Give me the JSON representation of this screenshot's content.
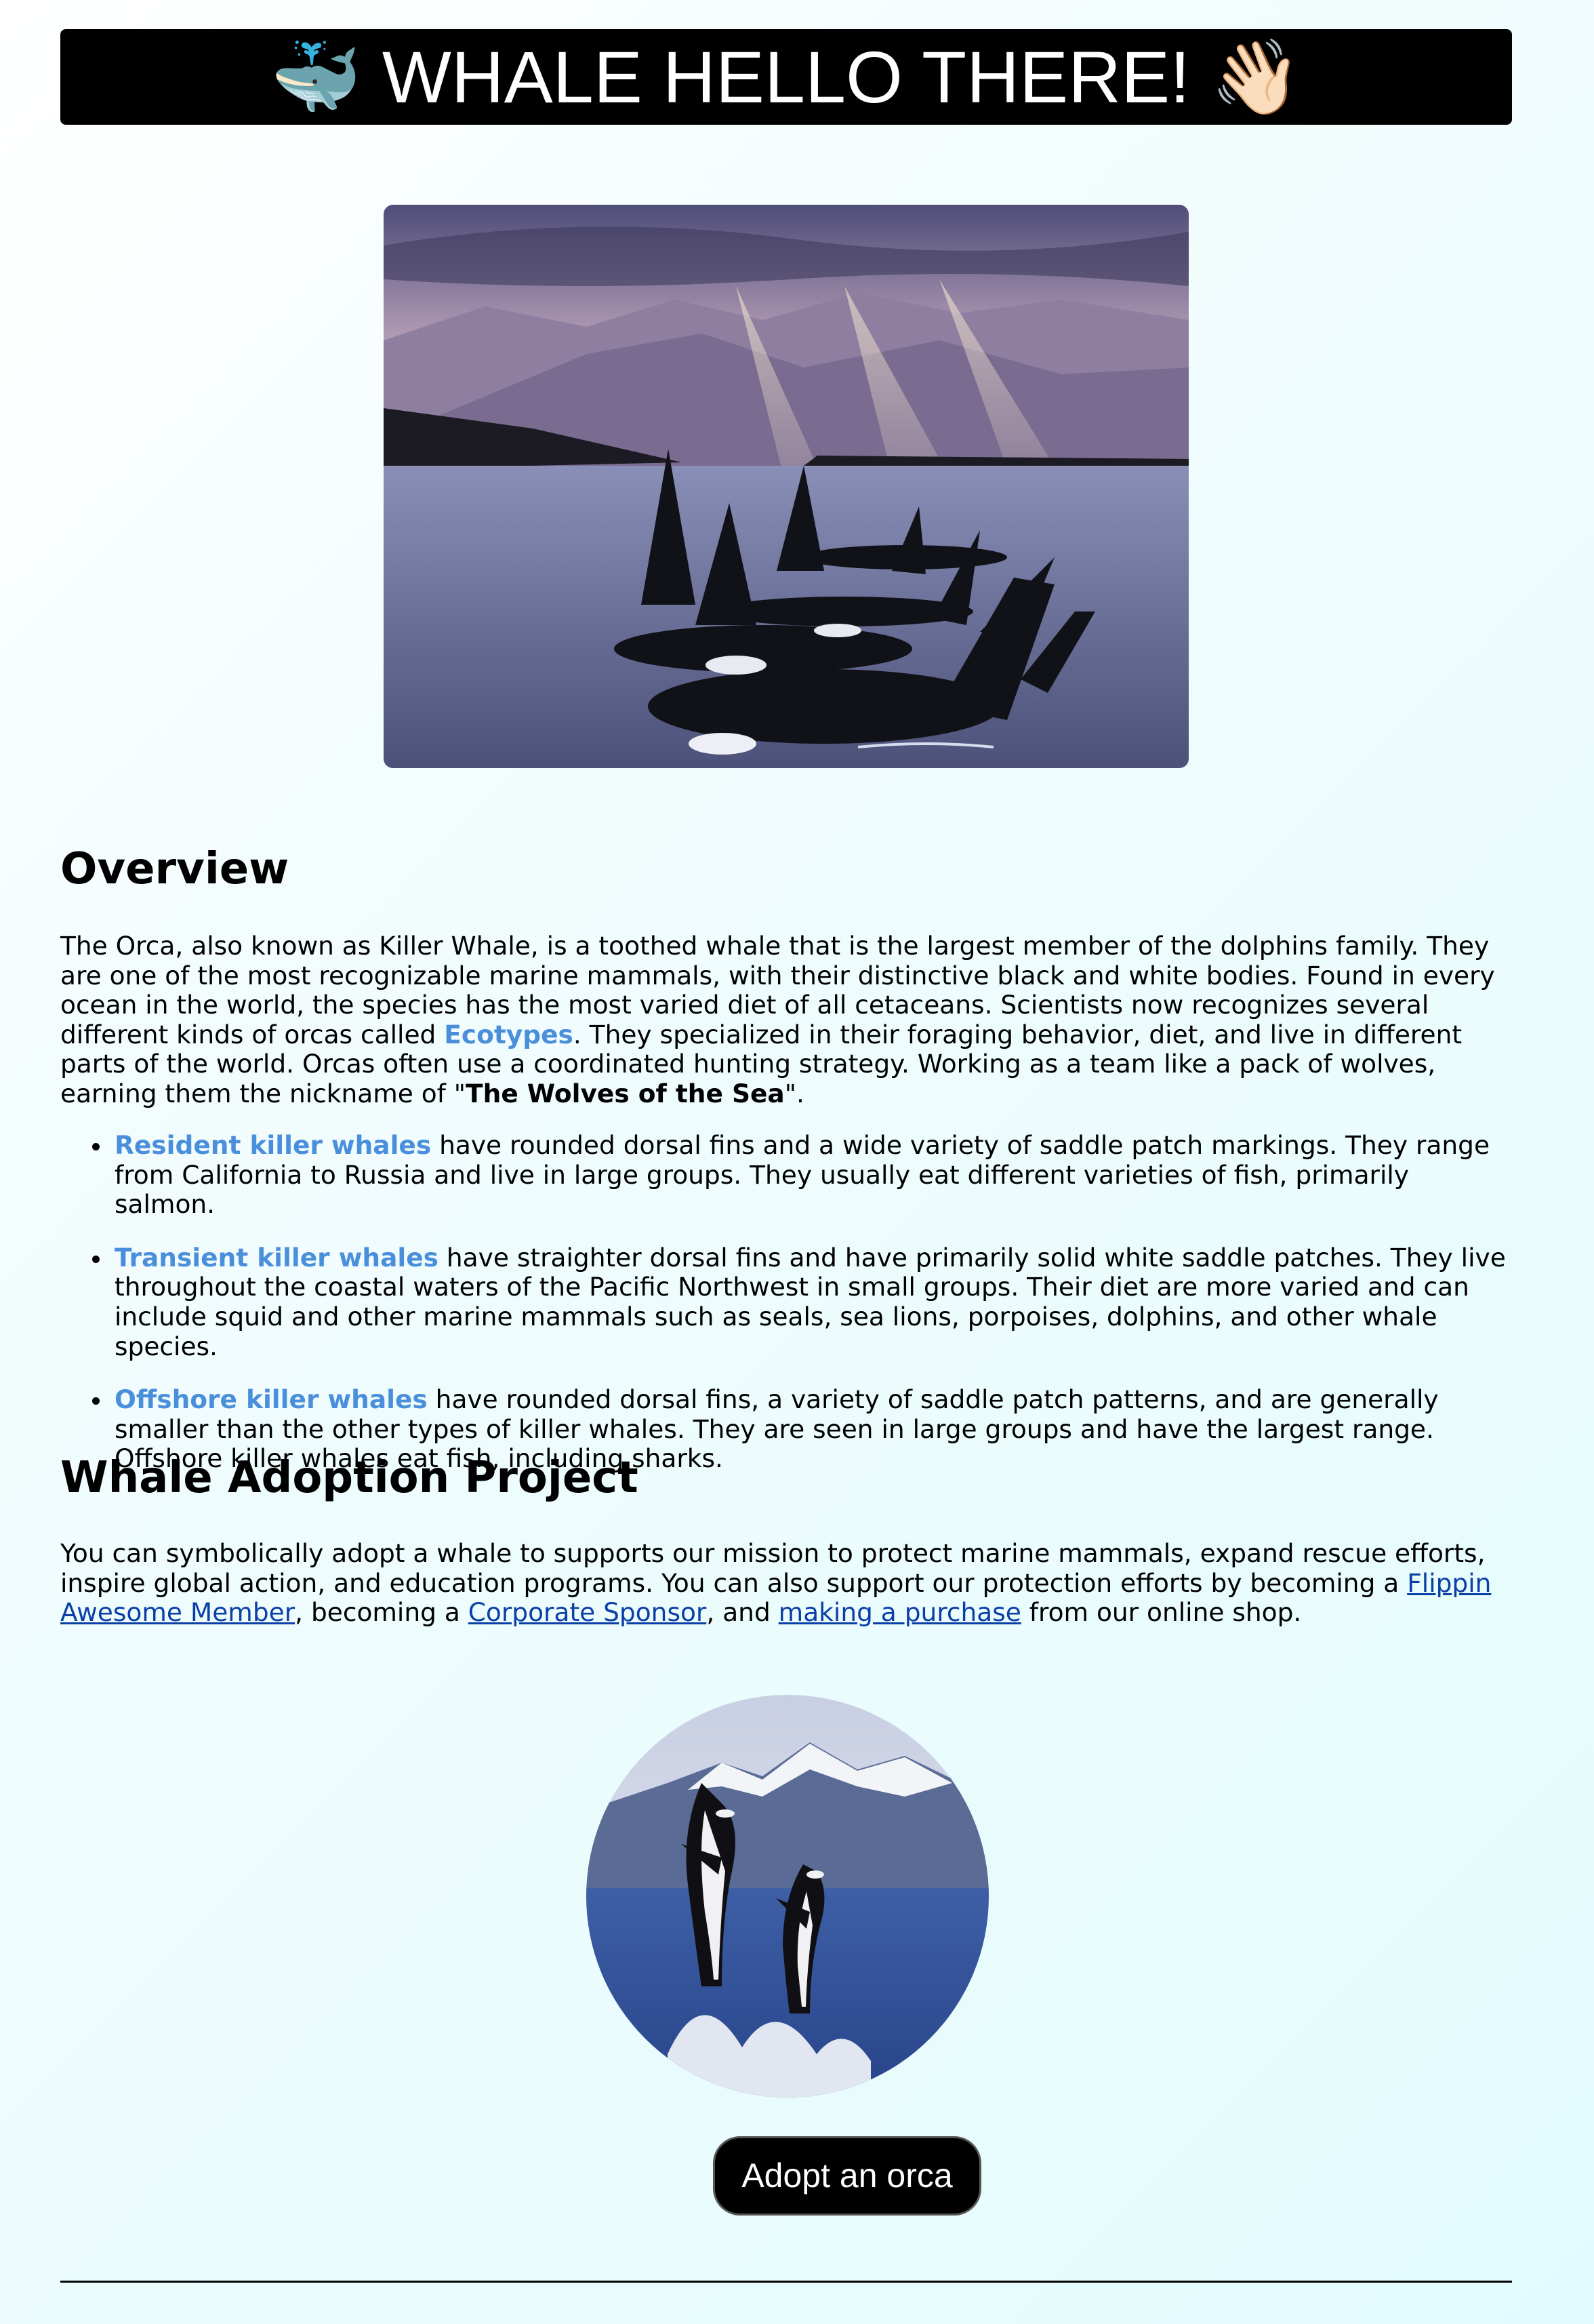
{
  "header": {
    "icon_left": "🐳",
    "title": "WHALE HELLO THERE!",
    "icon_right": "👋🏻"
  },
  "hero_image": {
    "icon": "orca-pod-photo"
  },
  "overview": {
    "heading": "Overview",
    "p1": "The Orca, also known as Killer Whale, is a toothed whale that is the largest member of the dolphins family. They are one of the most recognizable marine mammals, with their distinctive black and white bodies. Found in every ocean in the world, the species has the most varied diet of all cetaceans. Scientists now recognizes several different kinds of orcas called ",
    "ecotypes": "Ecotypes",
    "p2": ". They specialized in their foraging behavior, diet, and live in different parts of the world. Orcas often use a coordinated hunting strategy. Working as a team like a pack of wolves, earning them the nickname of \"",
    "nickname": "The Wolves of the Sea",
    "p3": "\".",
    "items": [
      {
        "name": "Resident killer whales",
        "text": " have rounded dorsal fins and a wide variety of saddle patch markings. They range from California to Russia and live in large groups. They usually eat different varieties of fish, primarily salmon."
      },
      {
        "name": "Transient killer whales",
        "text": " have straighter dorsal fins and have primarily solid white saddle patches. They live throughout the coastal waters of the Pacific Northwest in small groups. Their diet are more varied and can include squid and other marine mammals such as seals, sea lions, porpoises, dolphins, and other whale species."
      },
      {
        "name": "Offshore killer whales",
        "text": " have rounded dorsal fins, a variety of saddle patch patterns, and are generally smaller than the other types of killer whales. They are seen in large groups and have the largest range. Offshore killer whales eat fish, including sharks."
      }
    ]
  },
  "adoption": {
    "heading": "Whale Adoption Project",
    "p1": "You can symbolically adopt a whale to supports our mission to protect marine mammals, expand rescue efforts, inspire global action, and education programs. You can also support our protection efforts by becoming a ",
    "link1": "Flippin Awesome Member",
    "p2": ", becoming a ",
    "link2": "Corporate Sponsor",
    "p3": ", and ",
    "link3": "making a purchase",
    "p4": " from our online shop."
  },
  "adopt_image": {
    "icon": "jumping-orcas-photo"
  },
  "adopt_button": {
    "label": "Adopt an orca"
  },
  "colors": {
    "accent": "#4a8fdb",
    "link": "#0b3fa8",
    "header_bg": "#000000",
    "background": "#e2fcfd"
  }
}
